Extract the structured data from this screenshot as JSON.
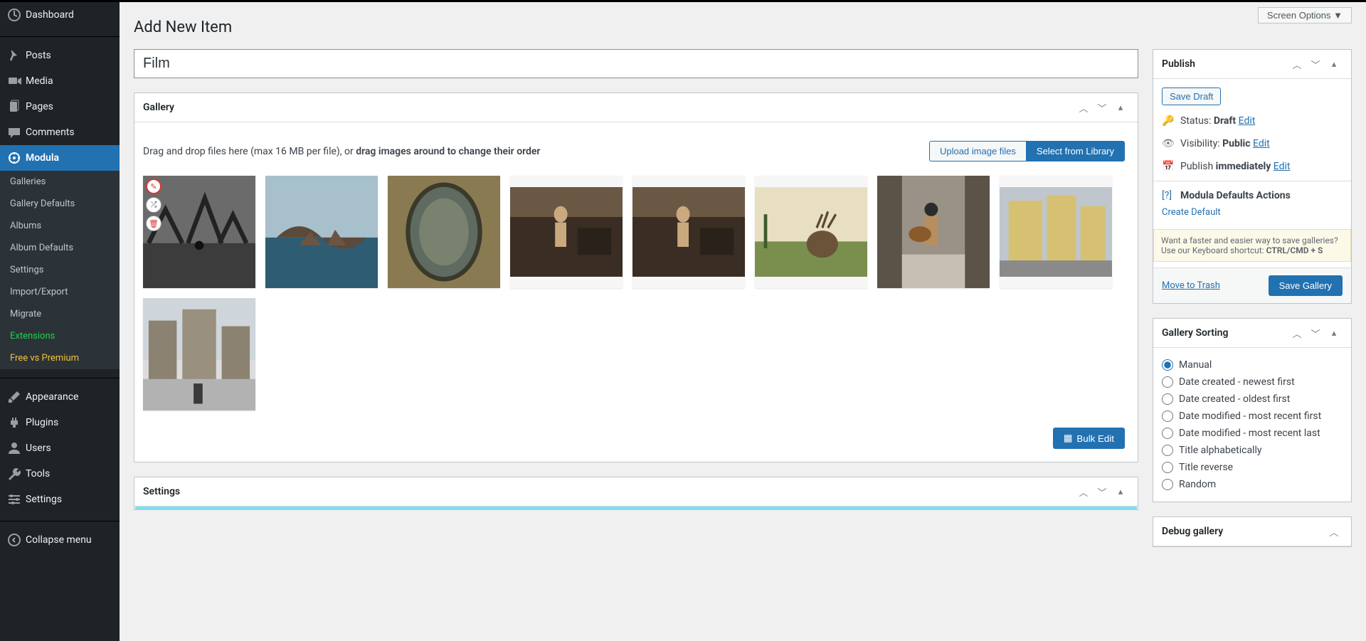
{
  "screen_options": "Screen Options  ▼",
  "page_title": "Add New Item",
  "title_value": "Film",
  "sidebar": {
    "items": [
      {
        "label": "Dashboard"
      },
      {
        "label": "Posts"
      },
      {
        "label": "Media"
      },
      {
        "label": "Pages"
      },
      {
        "label": "Comments"
      },
      {
        "label": "Modula"
      },
      {
        "label": "Appearance"
      },
      {
        "label": "Plugins"
      },
      {
        "label": "Users"
      },
      {
        "label": "Tools"
      },
      {
        "label": "Settings"
      },
      {
        "label": "Collapse menu"
      }
    ],
    "sub": [
      {
        "label": "Galleries"
      },
      {
        "label": "Gallery Defaults"
      },
      {
        "label": "Albums"
      },
      {
        "label": "Album Defaults"
      },
      {
        "label": "Settings"
      },
      {
        "label": "Import/Export"
      },
      {
        "label": "Migrate"
      },
      {
        "label": "Extensions"
      },
      {
        "label": "Free vs Premium"
      }
    ]
  },
  "gallery": {
    "title": "Gallery",
    "hint_pre": "Drag and drop files here (max 16 MB per file), or ",
    "hint_bold": "drag images around to change their order",
    "upload_btn": "Upload image files",
    "library_btn": "Select from Library",
    "bulk": "Bulk Edit"
  },
  "settings_box": {
    "title": "Settings"
  },
  "publish": {
    "title": "Publish",
    "save_draft": "Save Draft",
    "status_label": "Status: ",
    "status_value": "Draft",
    "edit": "Edit",
    "vis_label": "Visibility: ",
    "vis_value": "Public",
    "pub_label": "Publish ",
    "pub_value": "immediately",
    "defaults_title": "Modula Defaults Actions",
    "create_default": "Create Default",
    "kb_note_pre": "Want a faster and easier way to save galleries? Use our Keyboard shortcut: ",
    "kb_note_bold": "CTRL/CMD + S",
    "trash": "Move to Trash",
    "save_gallery": "Save Gallery"
  },
  "sorting": {
    "title": "Gallery Sorting",
    "options": [
      "Manual",
      "Date created - newest first",
      "Date created - oldest first",
      "Date modified - most recent first",
      "Date modified - most recent last",
      "Title alphabetically",
      "Title reverse",
      "Random"
    ],
    "selected": 0
  },
  "debug": {
    "title": "Debug gallery"
  }
}
